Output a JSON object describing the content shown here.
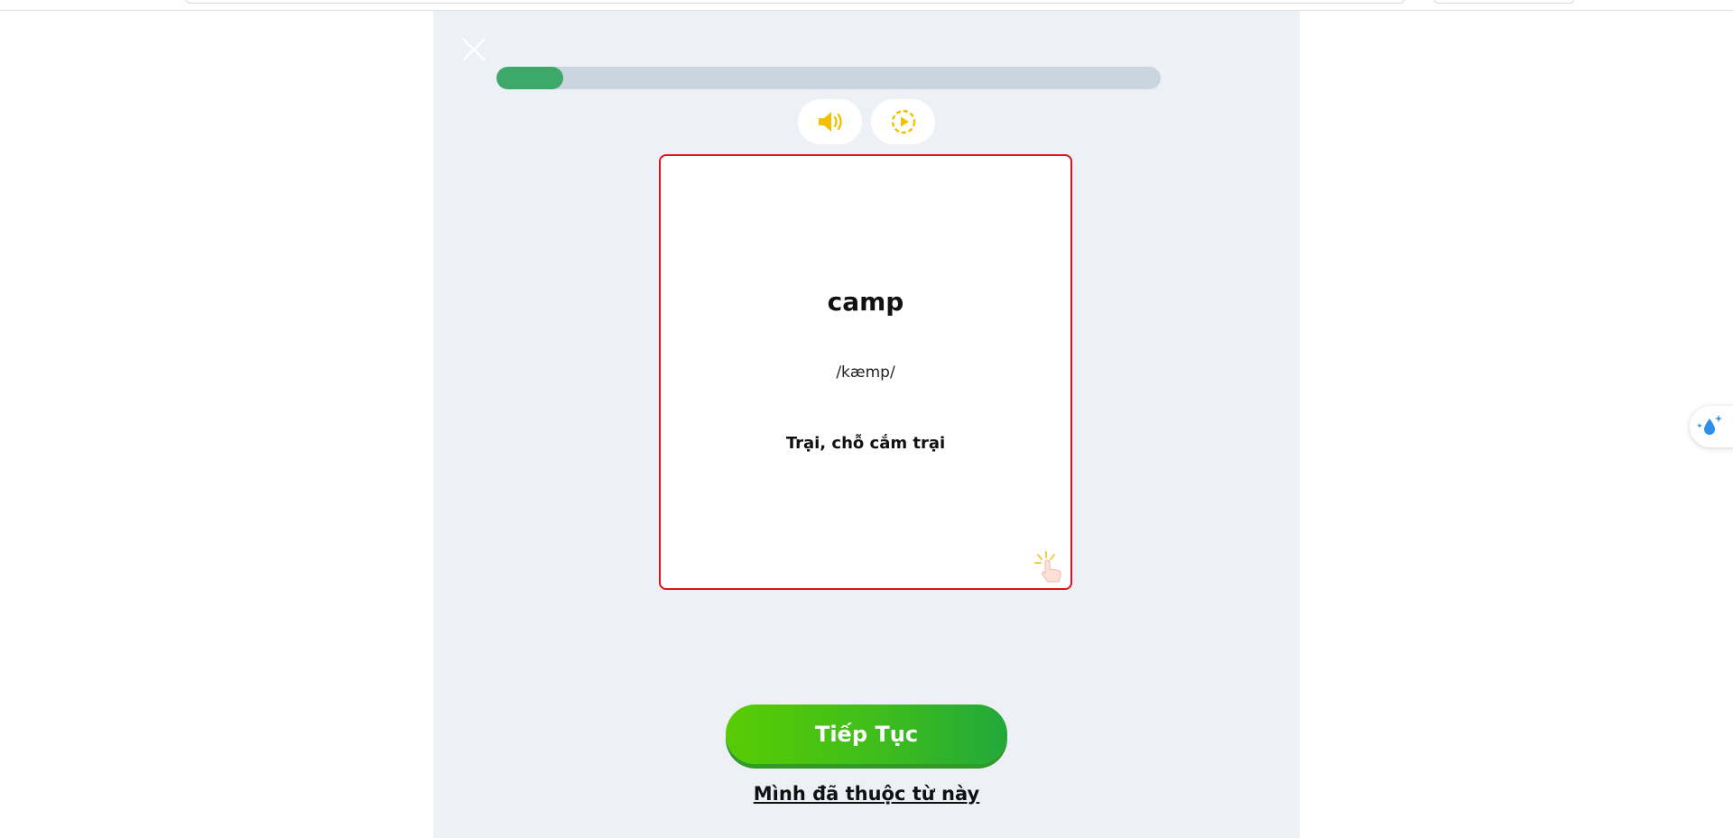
{
  "progress": {
    "fraction": 0.1
  },
  "toolbar": {
    "sound_icon": "speaker-icon",
    "replay_icon": "slow-play-icon",
    "close_icon": "close-icon"
  },
  "card": {
    "word": "camp",
    "phonetic": "/kæmp/",
    "meaning": "Trại, chỗ cắm trại",
    "tap_icon": "tap-hand-icon"
  },
  "actions": {
    "continue_label": "Tiếp Tục",
    "known_label": "Mình đã thuộc từ này"
  },
  "side_widget": {
    "icon": "sparkle-drop-icon"
  },
  "colors": {
    "accent_green": "#3da86a",
    "button_green_start": "#58cc02",
    "button_green_end": "#22a83a",
    "card_border": "#e3101a",
    "icon_yellow": "#f2c200",
    "panel_bg": "#edf1f5"
  }
}
